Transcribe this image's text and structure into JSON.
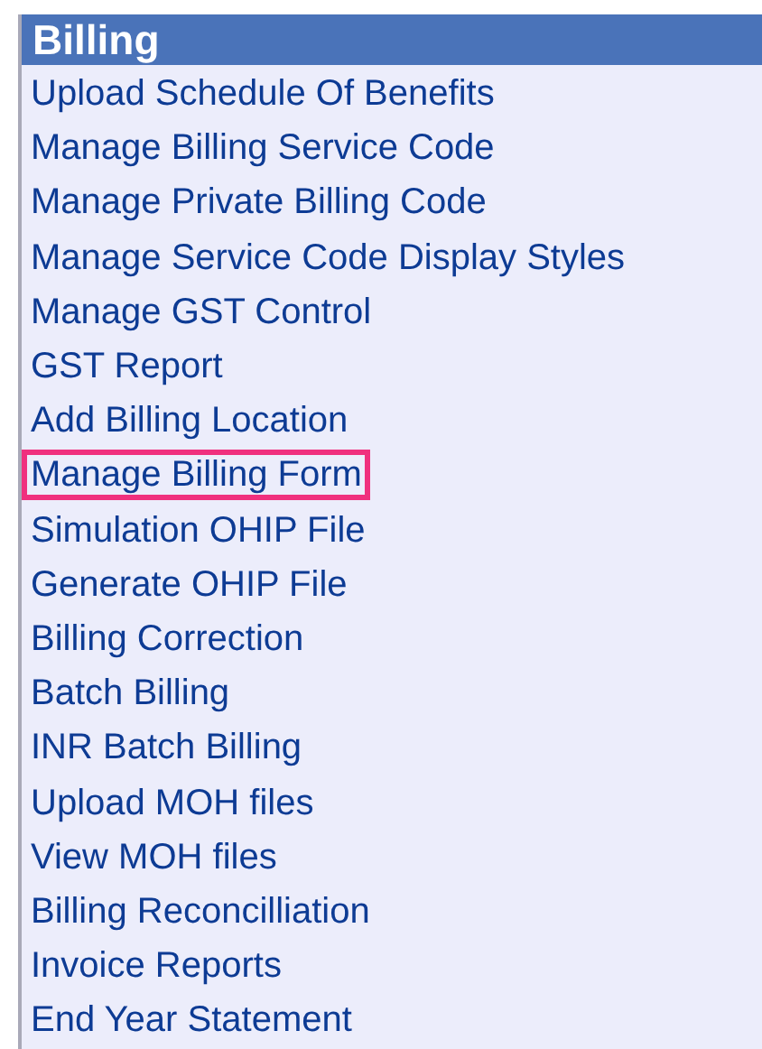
{
  "header": {
    "title": "Billing"
  },
  "items": [
    {
      "label": "Upload Schedule Of Benefits",
      "highlighted": false
    },
    {
      "label": "Manage Billing Service Code",
      "highlighted": false
    },
    {
      "label": "Manage Private Billing Code",
      "highlighted": false
    },
    {
      "label": "Manage Service Code Display Styles",
      "highlighted": false
    },
    {
      "label": "Manage GST Control",
      "highlighted": false
    },
    {
      "label": "GST Report",
      "highlighted": false
    },
    {
      "label": "Add Billing Location",
      "highlighted": false
    },
    {
      "label": "Manage Billing Form",
      "highlighted": true
    },
    {
      "label": "Simulation OHIP File",
      "highlighted": false
    },
    {
      "label": "Generate OHIP File",
      "highlighted": false
    },
    {
      "label": "Billing Correction",
      "highlighted": false
    },
    {
      "label": "Batch Billing",
      "highlighted": false
    },
    {
      "label": "INR Batch Billing",
      "highlighted": false
    },
    {
      "label": "Upload MOH files",
      "highlighted": false
    },
    {
      "label": "View MOH files",
      "highlighted": false
    },
    {
      "label": "Billing Reconcilliation",
      "highlighted": false
    },
    {
      "label": "Invoice Reports",
      "highlighted": false
    },
    {
      "label": "End Year Statement",
      "highlighted": false
    }
  ]
}
